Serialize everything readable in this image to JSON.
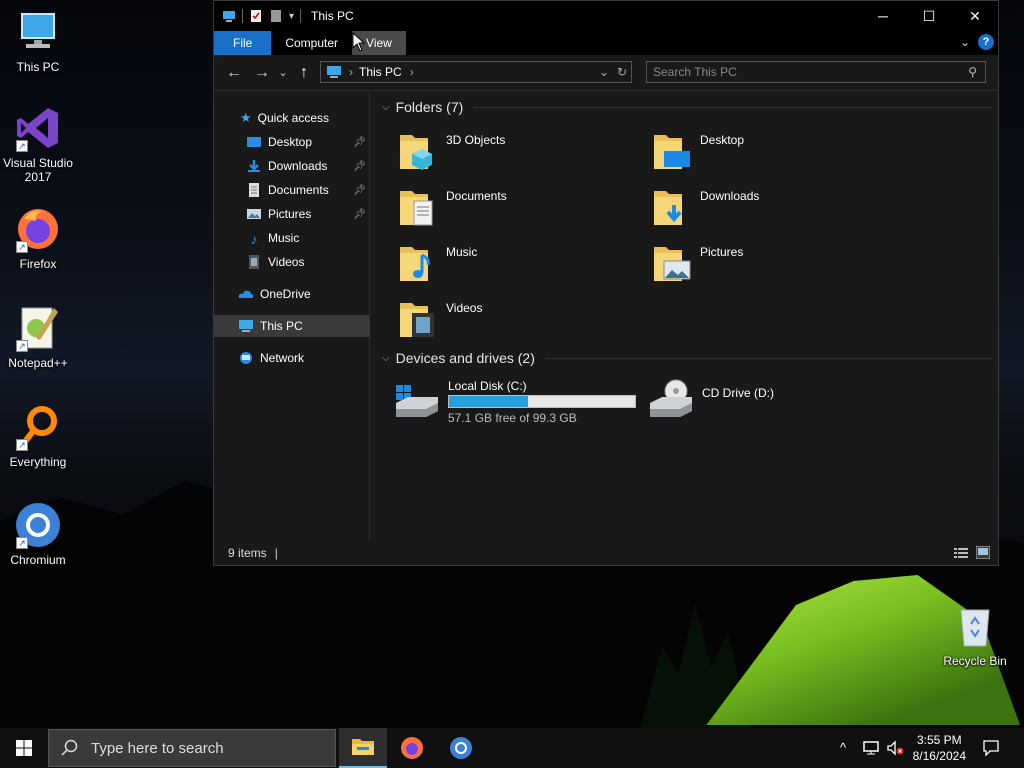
{
  "desktop": {
    "icons": [
      {
        "label": "This PC",
        "icon": "this-pc-icon"
      },
      {
        "label": "Visual Studio 2017",
        "icon": "visual-studio-icon"
      },
      {
        "label": "Firefox",
        "icon": "firefox-icon"
      },
      {
        "label": "Notepad++",
        "icon": "notepadpp-icon"
      },
      {
        "label": "Everything",
        "icon": "everything-icon"
      },
      {
        "label": "Chromium",
        "icon": "chromium-icon"
      },
      {
        "label": "Recycle Bin",
        "icon": "recycle-bin-icon"
      }
    ]
  },
  "window": {
    "title": "This PC",
    "controls": {
      "minimize": "─",
      "maximize": "☐",
      "close": "✕"
    }
  },
  "ribbon": {
    "tabs": [
      {
        "label": "File"
      },
      {
        "label": "Computer"
      },
      {
        "label": "View"
      }
    ],
    "help": "?"
  },
  "navbar": {
    "back": "←",
    "forward": "→",
    "recent": "⌄",
    "up": "↑",
    "address": "This PC",
    "search_placeholder": "Search This PC"
  },
  "navpane": {
    "items": [
      {
        "label": "Quick access",
        "icon": "star-icon",
        "pinned": false
      },
      {
        "label": "Desktop",
        "icon": "desktop-folder-icon",
        "pinned": true
      },
      {
        "label": "Downloads",
        "icon": "downloads-icon",
        "pinned": true
      },
      {
        "label": "Documents",
        "icon": "documents-icon",
        "pinned": true
      },
      {
        "label": "Pictures",
        "icon": "pictures-icon",
        "pinned": true
      },
      {
        "label": "Music",
        "icon": "music-icon",
        "pinned": false
      },
      {
        "label": "Videos",
        "icon": "videos-icon",
        "pinned": false
      },
      {
        "label": "OneDrive",
        "icon": "onedrive-icon",
        "pinned": false
      },
      {
        "label": "This PC",
        "icon": "this-pc-icon",
        "pinned": false,
        "selected": true
      },
      {
        "label": "Network",
        "icon": "network-icon",
        "pinned": false
      }
    ]
  },
  "content": {
    "folders_header": "Folders (7)",
    "folders": [
      {
        "label": "3D Objects",
        "icon": "3d-objects-folder-icon"
      },
      {
        "label": "Desktop",
        "icon": "desktop-folder-icon"
      },
      {
        "label": "Documents",
        "icon": "documents-folder-icon"
      },
      {
        "label": "Downloads",
        "icon": "downloads-folder-icon"
      },
      {
        "label": "Music",
        "icon": "music-folder-icon"
      },
      {
        "label": "Pictures",
        "icon": "pictures-folder-icon"
      },
      {
        "label": "Videos",
        "icon": "videos-folder-icon"
      }
    ],
    "drives_header": "Devices and drives (2)",
    "drives": [
      {
        "label": "Local Disk (C:)",
        "free_text": "57.1 GB free of 99.3 GB",
        "used_fraction": 0.425,
        "icon": "hard-disk-icon"
      },
      {
        "label": "CD Drive (D:)",
        "icon": "cd-drive-icon"
      }
    ]
  },
  "status": {
    "items_count": "9 items"
  },
  "taskbar": {
    "search_placeholder": "Type here to search",
    "time": "3:55 PM",
    "date": "8/16/2024",
    "tray_chevron": "^"
  },
  "colors": {
    "accent": "#1a6fc8",
    "drive_bar": "#26a0da",
    "window_bg": "#191919"
  }
}
